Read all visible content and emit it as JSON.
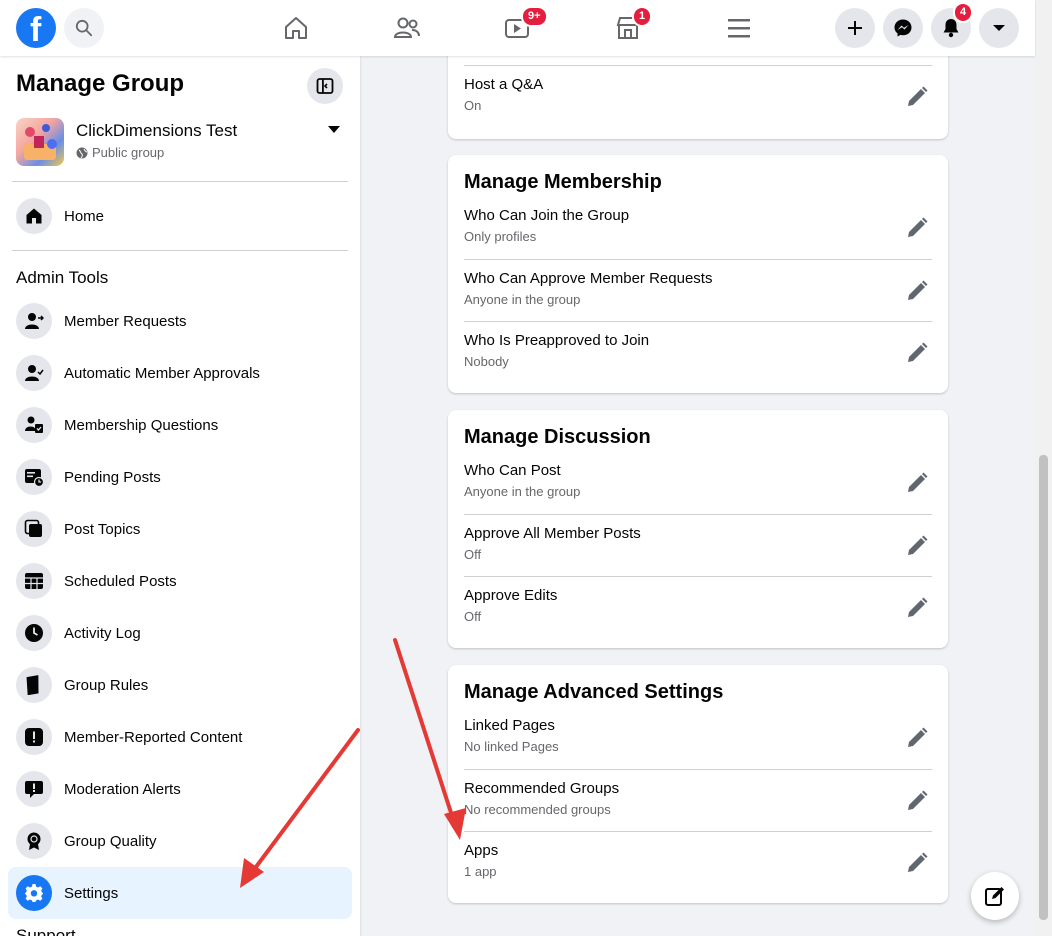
{
  "topbar": {
    "logo_letter": "f",
    "watch_badge": "9+",
    "marketplace_badge": "1",
    "notifications_badge": "4"
  },
  "sidebar": {
    "title": "Manage Group",
    "group_name": "ClickDimensions Test",
    "group_privacy": "Public group",
    "home_label": "Home",
    "admin_tools_heading": "Admin Tools",
    "items": [
      {
        "label": "Member Requests",
        "icon": "member-requests-icon"
      },
      {
        "label": "Automatic Member Approvals",
        "icon": "auto-approvals-icon"
      },
      {
        "label": "Membership Questions",
        "icon": "membership-questions-icon"
      },
      {
        "label": "Pending Posts",
        "icon": "pending-posts-icon"
      },
      {
        "label": "Post Topics",
        "icon": "post-topics-icon"
      },
      {
        "label": "Scheduled Posts",
        "icon": "scheduled-posts-icon"
      },
      {
        "label": "Activity Log",
        "icon": "clock-icon"
      },
      {
        "label": "Group Rules",
        "icon": "book-icon"
      },
      {
        "label": "Member-Reported Content",
        "icon": "exclamation-icon"
      },
      {
        "label": "Moderation Alerts",
        "icon": "alert-icon"
      },
      {
        "label": "Group Quality",
        "icon": "quality-badge-icon"
      },
      {
        "label": "Settings",
        "icon": "gear-icon",
        "active": true
      }
    ],
    "support_heading": "Support"
  },
  "main": {
    "top_card": {
      "setting": {
        "name": "Host a Q&A",
        "value": "On"
      }
    },
    "membership": {
      "title": "Manage Membership",
      "settings": [
        {
          "name": "Who Can Join the Group",
          "value": "Only profiles"
        },
        {
          "name": "Who Can Approve Member Requests",
          "value": "Anyone in the group"
        },
        {
          "name": "Who Is Preapproved to Join",
          "value": "Nobody"
        }
      ]
    },
    "discussion": {
      "title": "Manage Discussion",
      "settings": [
        {
          "name": "Who Can Post",
          "value": "Anyone in the group"
        },
        {
          "name": "Approve All Member Posts",
          "value": "Off"
        },
        {
          "name": "Approve Edits",
          "value": "Off"
        }
      ]
    },
    "advanced": {
      "title": "Manage Advanced Settings",
      "settings": [
        {
          "name": "Linked Pages",
          "value": "No linked Pages"
        },
        {
          "name": "Recommended Groups",
          "value": "No recommended groups"
        },
        {
          "name": "Apps",
          "value": "1 app"
        }
      ]
    }
  },
  "colors": {
    "brand": "#1877f2",
    "badge": "#e41e3f",
    "annotation_arrow": "#e53935",
    "active_bg": "#e7f3ff"
  }
}
